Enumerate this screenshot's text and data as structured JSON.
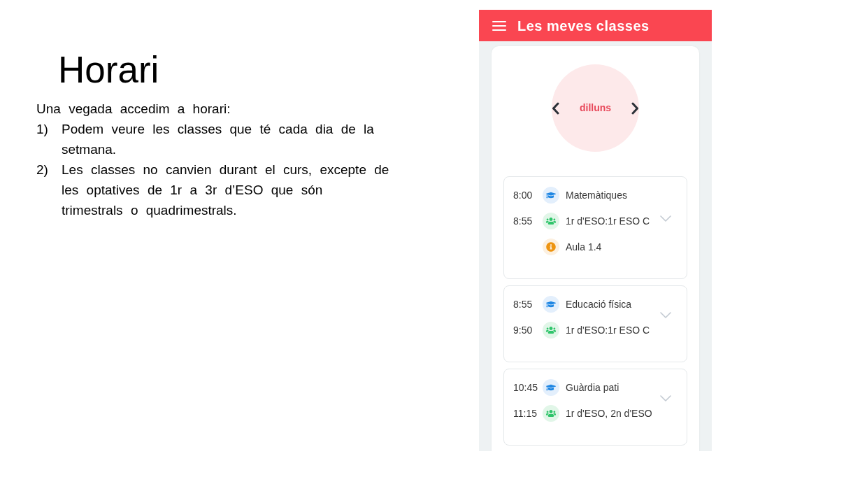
{
  "slide": {
    "title": "Horari",
    "intro": "Una vegada accedim a horari:",
    "points": [
      {
        "number": "1)",
        "text": "Podem veure les classes que té cada dia de la setmana."
      },
      {
        "number": "2)",
        "text": "Les classes no canvien durant el curs, excepte de les optatives de 1r a 3r d’ESO que són trimestrals o quadrimestrals."
      }
    ]
  },
  "app": {
    "header": {
      "title": "Les meves classes"
    },
    "day": "dilluns",
    "classes": [
      {
        "start": "8:00",
        "end": "8:55",
        "expanded": false,
        "rows": [
          {
            "kind": "subject",
            "text": "Matemàtiques"
          },
          {
            "kind": "group",
            "text": "1r d'ESO:1r ESO C"
          },
          {
            "kind": "room",
            "text": "Aula 1.4"
          }
        ]
      },
      {
        "start": "8:55",
        "end": "9:50",
        "expanded": false,
        "rows": [
          {
            "kind": "subject",
            "text": "Educació física"
          },
          {
            "kind": "group",
            "text": "1r d'ESO:1r ESO C"
          }
        ]
      },
      {
        "start": "10:45",
        "end": "11:15",
        "expanded": false,
        "rows": [
          {
            "kind": "subject",
            "text": "Guàrdia pati"
          },
          {
            "kind": "group",
            "text": "1r d'ESO, 2n d'ESO"
          }
        ]
      }
    ]
  }
}
